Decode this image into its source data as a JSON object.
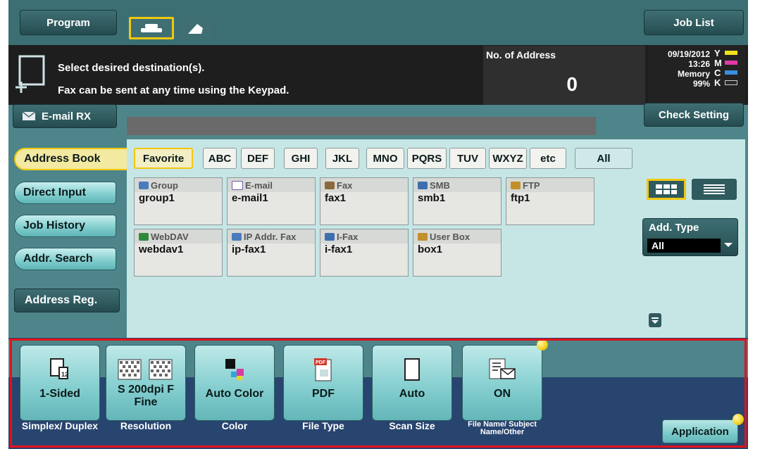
{
  "top": {
    "program": "Program",
    "job_list": "Job List",
    "fax_icon": "fax-handset-icon",
    "onhook_icon": "onhook-icon"
  },
  "message": {
    "line1": "Select desired destination(s).",
    "line2": "Fax can be sent at any time using the Keypad.",
    "no_of_address_label": "No. of Address",
    "no_of_address_value": "0",
    "date": "09/19/2012",
    "time": "13:26",
    "memory_label": "Memory",
    "memory_value": "99%",
    "toner": [
      {
        "letter": "Y",
        "color": "#f2e21a"
      },
      {
        "letter": "M",
        "color": "#e03aa8"
      },
      {
        "letter": "C",
        "color": "#3b8fe0"
      },
      {
        "letter": "K",
        "color": "#2a2a2a"
      }
    ]
  },
  "email_rx": "E-mail RX",
  "check_setting": "Check Setting",
  "left_tabs": [
    "Address Book",
    "Direct Input",
    "Job History",
    "Addr. Search",
    "Address Reg."
  ],
  "index_tabs": [
    "Favorite",
    "ABC",
    "DEF",
    "GHI",
    "JKL",
    "MNO",
    "PQRS",
    "TUV",
    "WXYZ",
    "etc",
    "All"
  ],
  "addresses": [
    {
      "type": "Group",
      "name": "group1",
      "icon_color": "#4a7bbd"
    },
    {
      "type": "E-mail",
      "name": "e-mail1",
      "icon_color": "#6b5aa8"
    },
    {
      "type": "Fax",
      "name": "fax1",
      "icon_color": "#8a6a3a"
    },
    {
      "type": "SMB",
      "name": "smb1",
      "icon_color": "#3d6fb0"
    },
    {
      "type": "FTP",
      "name": "ftp1",
      "icon_color": "#c2902a"
    },
    {
      "type": "WebDAV",
      "name": "webdav1",
      "icon_color": "#2e8a3a"
    },
    {
      "type": "IP Addr. Fax",
      "name": "ip-fax1",
      "icon_color": "#4a7bbd"
    },
    {
      "type": "I-Fax",
      "name": "i-fax1",
      "icon_color": "#3d6fb0"
    },
    {
      "type": "User Box",
      "name": "box1",
      "icon_color": "#c2902a"
    }
  ],
  "add_type": {
    "label": "Add. Type",
    "value": "All"
  },
  "settings": [
    {
      "value": "1-Sided",
      "caption": "Simplex/ Duplex",
      "icon": "simplex-icon"
    },
    {
      "value": "S 200dpi F Fine",
      "caption": "Resolution",
      "icon": "resolution-icon"
    },
    {
      "value": "Auto Color",
      "caption": "Color",
      "icon": "color-icon"
    },
    {
      "value": "PDF",
      "caption": "File Type",
      "icon": "pdf-icon"
    },
    {
      "value": "Auto",
      "caption": "Scan Size",
      "icon": "scan-size-icon"
    },
    {
      "value": "ON",
      "caption": "File Name/ Subject Name/Other",
      "icon": "file-name-icon"
    }
  ],
  "application": "Application"
}
